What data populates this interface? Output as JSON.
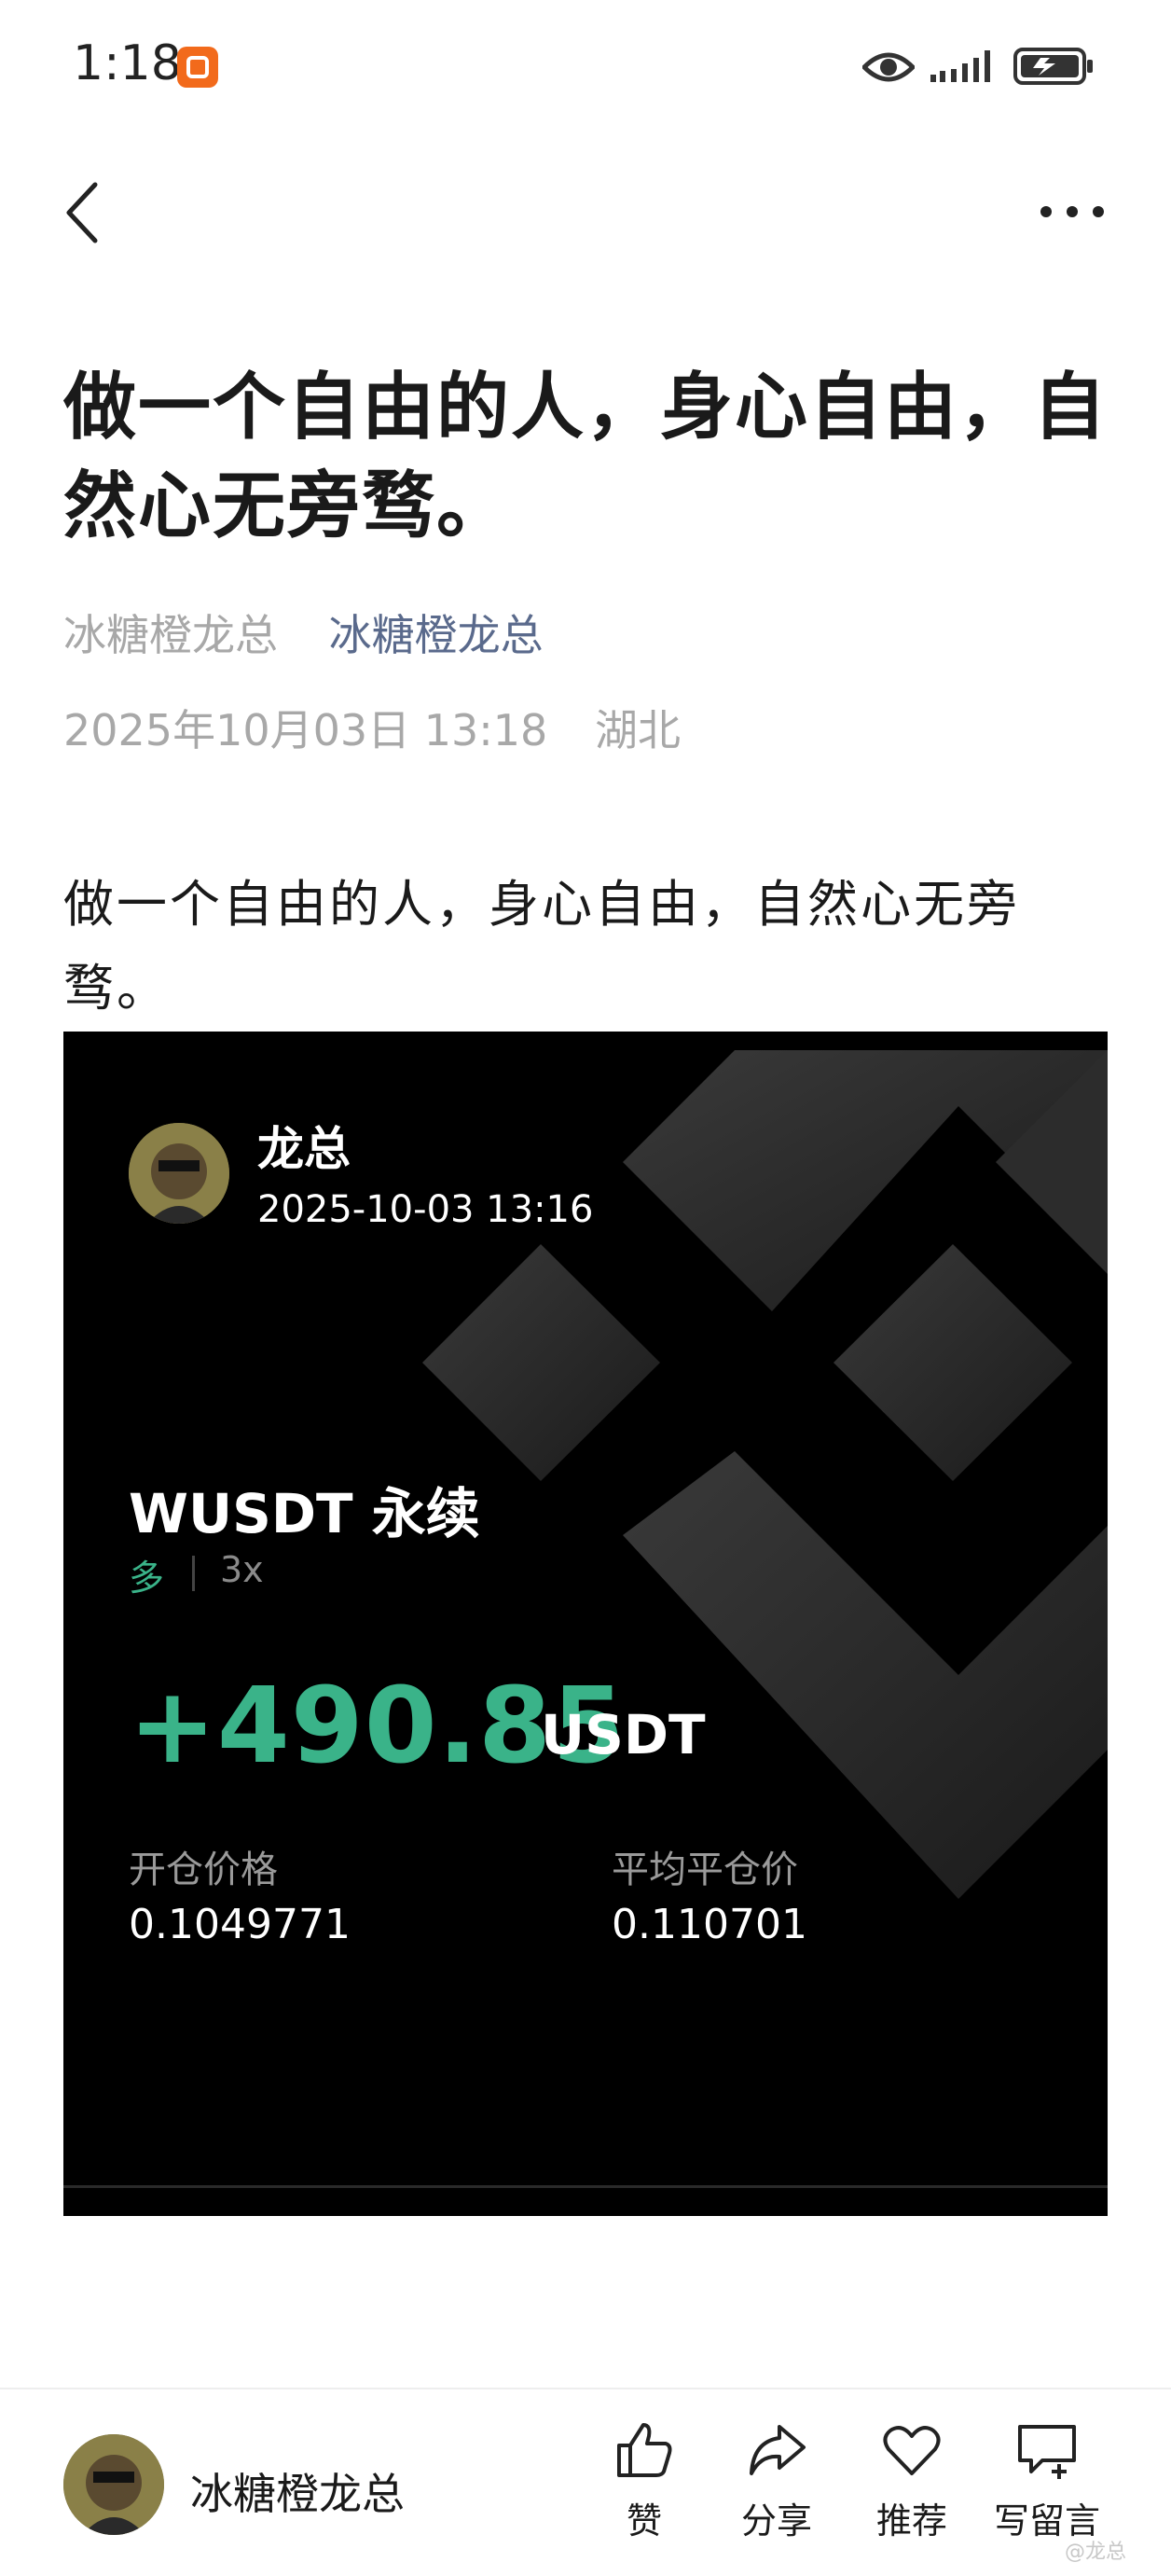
{
  "status_bar": {
    "time": "1:18",
    "icons": [
      "app-badge-icon",
      "eye-icon",
      "signal-icon",
      "battery-charging-icon"
    ]
  },
  "nav": {
    "back_icon": "chevron-left-icon",
    "more_icon": "more-dots-icon"
  },
  "article": {
    "title": "做一个自由的人，身心自由，自然心无旁骛。",
    "author_plain": "冰糖橙龙总",
    "author_link": "冰糖橙龙总",
    "datetime": "2025年10月03日 13:18",
    "location": "湖北",
    "body": " 做一个自由的人，身心自由，自然心无旁骛。"
  },
  "card": {
    "username": "龙总",
    "timestamp": "2025-10-03 13:16",
    "pair": "WUSDT 永续",
    "side": "多",
    "leverage": "3x",
    "pnl": "+490.85",
    "pnl_unit": "USDT",
    "entry_label": "开仓价格",
    "entry_value": "0.1049771",
    "exit_label": "平均平仓价",
    "exit_value": "0.110701",
    "pnl_color": "#3ab389"
  },
  "footer": {
    "author": "冰糖橙龙总",
    "actions": {
      "like": "赞",
      "share": "分享",
      "recommend": "推荐",
      "comment": "写留言"
    }
  },
  "watermark": "@龙总"
}
